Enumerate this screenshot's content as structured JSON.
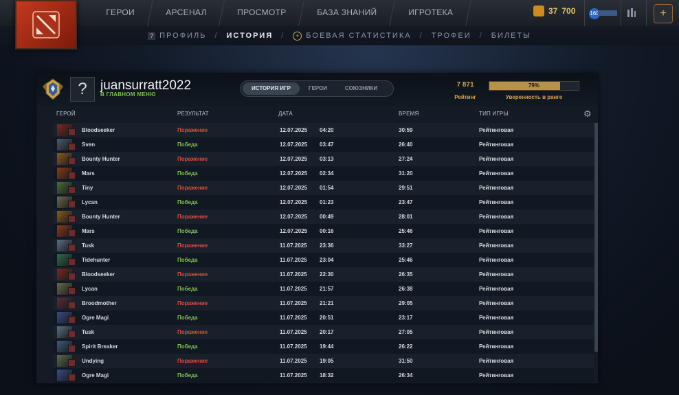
{
  "nav": {
    "items": [
      "ГЕРОИ",
      "АРСЕНАЛ",
      "ПРОСМОТР",
      "БАЗА ЗНАНИЙ",
      "ИГРОТЕКА"
    ]
  },
  "topright": {
    "shards_1": "37",
    "shards_2": "700",
    "level": "160"
  },
  "subnav": {
    "profile": "ПРОФИЛЬ",
    "history": "ИСТОРИЯ",
    "stats": "БОЕВАЯ СТАТИСТИКА",
    "trophies": "ТРОФЕИ",
    "tickets": "БИЛЕТЫ",
    "sep": "/"
  },
  "profile": {
    "avatar_glyph": "?",
    "username": "juansurratt2022",
    "status": "В ГЛАВНОМ МЕНЮ"
  },
  "tabs": [
    "ИСТОРИЯ ИГР",
    "ГЕРОИ",
    "СОЮЗНИКИ"
  ],
  "rank": {
    "rating": "7 871",
    "rating_label": "Рейтинг",
    "confidence": "79%",
    "confidence_fraction": 0.79,
    "confidence_label": "Уверенность в ранге"
  },
  "columns": {
    "hero": "ГЕРОЙ",
    "result": "РЕЗУЛЬТАТ",
    "date": "ДАТА",
    "duration": "ВРЕМЯ",
    "mode": "ТИП ИГРЫ"
  },
  "matches": [
    {
      "hero": "Bloodseeker",
      "result": "Поражение",
      "win": false,
      "date": "12.07.2025",
      "time": "04:20",
      "duration": "30:59",
      "mode": "Рейтинговая",
      "color": "#7a2a1e"
    },
    {
      "hero": "Sven",
      "result": "Победа",
      "win": true,
      "date": "12.07.2025",
      "time": "03:47",
      "duration": "26:40",
      "mode": "Рейтинговая",
      "color": "#4a5a6e"
    },
    {
      "hero": "Bounty Hunter",
      "result": "Поражение",
      "win": false,
      "date": "12.07.2025",
      "time": "03:13",
      "duration": "27:24",
      "mode": "Рейтинговая",
      "color": "#8a5a1e"
    },
    {
      "hero": "Mars",
      "result": "Победа",
      "win": true,
      "date": "12.07.2025",
      "time": "02:34",
      "duration": "31:20",
      "mode": "Рейтинговая",
      "color": "#8a3a1a"
    },
    {
      "hero": "Tiny",
      "result": "Поражение",
      "win": false,
      "date": "12.07.2025",
      "time": "01:54",
      "duration": "29:51",
      "mode": "Рейтинговая",
      "color": "#4e6a3a"
    },
    {
      "hero": "Lycan",
      "result": "Победа",
      "win": true,
      "date": "12.07.2025",
      "time": "01:23",
      "duration": "23:47",
      "mode": "Рейтинговая",
      "color": "#6a6a4a"
    },
    {
      "hero": "Bounty Hunter",
      "result": "Поражение",
      "win": false,
      "date": "12.07.2025",
      "time": "00:49",
      "duration": "28:01",
      "mode": "Рейтинговая",
      "color": "#8a5a1e"
    },
    {
      "hero": "Mars",
      "result": "Победа",
      "win": true,
      "date": "12.07.2025",
      "time": "00:16",
      "duration": "25:46",
      "mode": "Рейтинговая",
      "color": "#8a3a1a"
    },
    {
      "hero": "Tusk",
      "result": "Поражение",
      "win": false,
      "date": "11.07.2025",
      "time": "23:36",
      "duration": "33:27",
      "mode": "Рейтинговая",
      "color": "#5a6e84"
    },
    {
      "hero": "Tidehunter",
      "result": "Победа",
      "win": true,
      "date": "11.07.2025",
      "time": "23:04",
      "duration": "25:46",
      "mode": "Рейтинговая",
      "color": "#2e6a4a"
    },
    {
      "hero": "Bloodseeker",
      "result": "Поражение",
      "win": false,
      "date": "11.07.2025",
      "time": "22:30",
      "duration": "26:35",
      "mode": "Рейтинговая",
      "color": "#7a2a1e"
    },
    {
      "hero": "Lycan",
      "result": "Победа",
      "win": true,
      "date": "11.07.2025",
      "time": "21:57",
      "duration": "26:38",
      "mode": "Рейтинговая",
      "color": "#6a6a4a"
    },
    {
      "hero": "Broodmother",
      "result": "Поражение",
      "win": false,
      "date": "11.07.2025",
      "time": "21:21",
      "duration": "29:05",
      "mode": "Рейтинговая",
      "color": "#5a2a3a"
    },
    {
      "hero": "Ogre Magi",
      "result": "Победа",
      "win": true,
      "date": "11.07.2025",
      "time": "20:51",
      "duration": "23:17",
      "mode": "Рейтинговая",
      "color": "#3a4a8a"
    },
    {
      "hero": "Tusk",
      "result": "Поражение",
      "win": false,
      "date": "11.07.2025",
      "time": "20:17",
      "duration": "27:05",
      "mode": "Рейтинговая",
      "color": "#5a6e84"
    },
    {
      "hero": "Spirit Breaker",
      "result": "Победа",
      "win": true,
      "date": "11.07.2025",
      "time": "19:44",
      "duration": "26:22",
      "mode": "Рейтинговая",
      "color": "#3a5a7a"
    },
    {
      "hero": "Undying",
      "result": "Поражение",
      "win": false,
      "date": "11.07.2025",
      "time": "19:05",
      "duration": "31:50",
      "mode": "Рейтинговая",
      "color": "#5a6a4a"
    },
    {
      "hero": "Ogre Magi",
      "result": "Победа",
      "win": true,
      "date": "11.07.2025",
      "time": "18:32",
      "duration": "26:34",
      "mode": "Рейтинговая",
      "color": "#3a4a8a"
    }
  ],
  "colors": {
    "win": "#7ec24f",
    "loss": "#e04a3b",
    "gold": "#d9a545"
  }
}
